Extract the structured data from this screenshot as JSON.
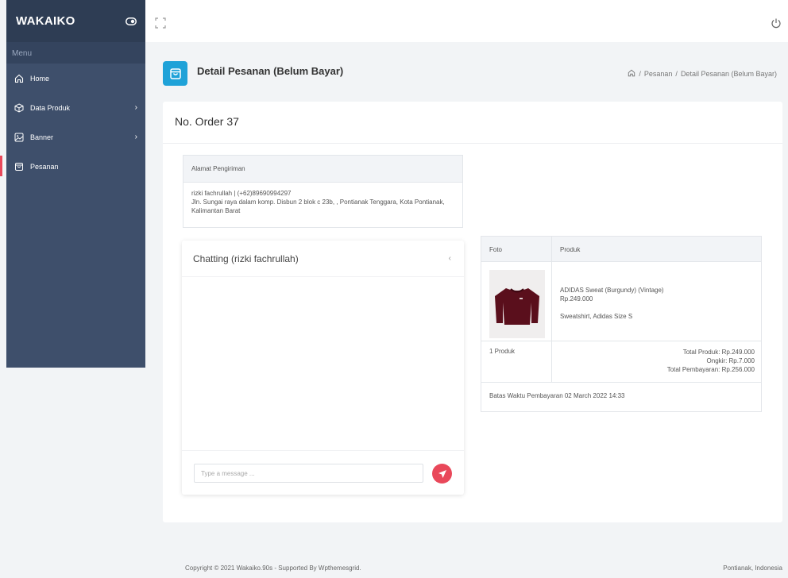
{
  "sidebar": {
    "brand": "WAKAIKO",
    "menu_header": "Menu",
    "items": [
      {
        "label": "Home",
        "icon": "home-icon"
      },
      {
        "label": "Data Produk",
        "icon": "box-icon"
      },
      {
        "label": "Banner",
        "icon": "image-icon"
      },
      {
        "label": "Pesanan",
        "icon": "shopping-bag-icon"
      }
    ]
  },
  "page": {
    "title": "Detail Pesanan (Belum Bayar)",
    "breadcrumb": [
      "Pesanan",
      "Detail Pesanan (Belum Bayar)"
    ],
    "breadcrumb_sep": "/"
  },
  "order": {
    "title": "No. Order 37",
    "address_header": "Alamat Pengiriman",
    "address_name": "rizki fachrullah | (+62)89690994297",
    "address_line": "Jln. Sungai raya dalam komp. Disbun 2 blok c 23b, , Pontianak Tenggara, Kota Pontianak, Kalimantan Barat"
  },
  "chat": {
    "title": "Chatting (rizki fachrullah)",
    "placeholder": "Type a message ..."
  },
  "products": {
    "col_photo": "Foto",
    "col_product": "Produk",
    "item_name": "ADIDAS Sweat (Burgundy) (Vintage)",
    "item_price": "Rp.249.000",
    "item_desc": "Sweatshirt, Adidas Size S",
    "count": "1 Produk",
    "total_produk": "Total Produk: Rp.249.000",
    "ongkir": "Ongkir: Rp.7.000",
    "total_bayar": "Total Pembayaran: Rp.256.000",
    "deadline": "Batas Waktu Pembayaran 02 March 2022 14:33"
  },
  "footer": {
    "copyright": "Copyright © 2021 Wakaiko.90s - Supported By Wpthemesgrid.",
    "location": "Pontianak, Indonesia"
  },
  "colors": {
    "sidebar": "#3e4f6b",
    "accent": "#1fa2d8",
    "send": "#e9485a"
  }
}
